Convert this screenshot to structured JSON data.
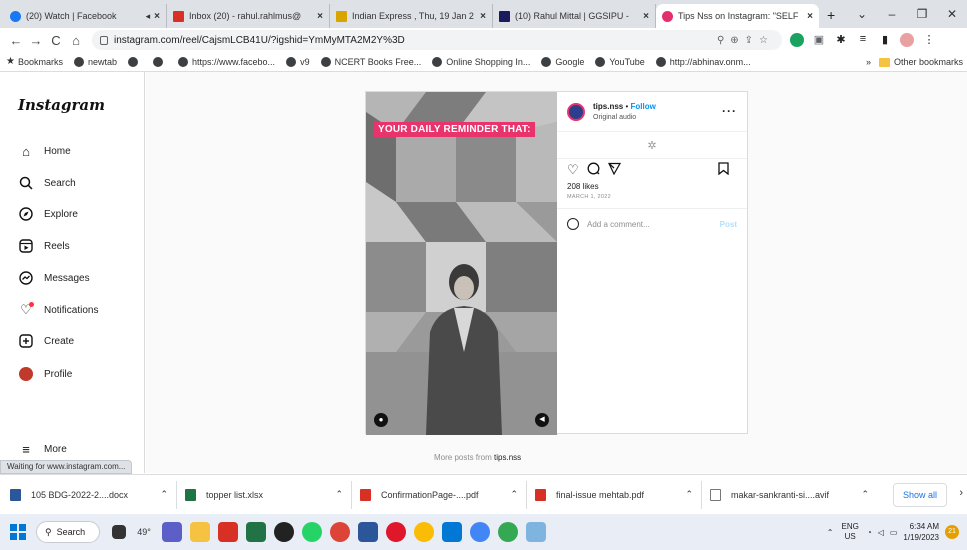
{
  "browser": {
    "tabs": [
      {
        "title": "(20) Watch | Facebook",
        "color": "#1877f2"
      },
      {
        "title": "Inbox (20) - rahul.rahlmus@",
        "color": "#d93025"
      },
      {
        "title": "Indian Express , Thu, 19 Jan 2",
        "color": "#d8a400"
      },
      {
        "title": "(10) Rahul Mittal | GGSIPU -",
        "color": "#1a1a5e"
      },
      {
        "title": "Tips Nss on Instagram: \"SELF",
        "color": "#e1306c"
      }
    ],
    "url": "instagram.com/reel/CajsmLCB41U/?igshid=YmMyMTA2M2Y%3D",
    "bookmarks": [
      "Bookmarks",
      "newtab",
      "https://www.facebo...",
      "v9",
      "NCERT Books Free...",
      "Online Shopping In...",
      "Google",
      "YouTube",
      "http://abhinav.onm..."
    ],
    "other_bookmarks": "Other bookmarks"
  },
  "instagram": {
    "logo": "Instagram",
    "nav": [
      {
        "label": "Home",
        "icon": "home-icon"
      },
      {
        "label": "Search",
        "icon": "search-icon"
      },
      {
        "label": "Explore",
        "icon": "explore-icon"
      },
      {
        "label": "Reels",
        "icon": "reels-icon"
      },
      {
        "label": "Messages",
        "icon": "messages-icon"
      },
      {
        "label": "Notifications",
        "icon": "heart-icon"
      },
      {
        "label": "Create",
        "icon": "create-icon"
      },
      {
        "label": "Profile",
        "icon": "profile-icon"
      }
    ],
    "more": "More",
    "post": {
      "overlay_text": "YOUR DAILY REMINDER THAT:",
      "username": "tips.nss",
      "follow": "Follow",
      "separator": "•",
      "audio": "Original audio",
      "likes": "208 likes",
      "date": "MARCH 1, 2022",
      "comment_placeholder": "Add a comment...",
      "post_button": "Post"
    },
    "more_posts_prefix": "More posts from",
    "more_posts_user": "tips.nss"
  },
  "status": "Waiting for www.instagram.com...",
  "downloads": {
    "items": [
      {
        "name": "105 BDG-2022-2....docx",
        "color": "#2b579a"
      },
      {
        "name": "topper list.xlsx",
        "color": "#217346"
      },
      {
        "name": "ConfirmationPage-....pdf",
        "color": "#d93025"
      },
      {
        "name": "final-issue mehtab.pdf",
        "color": "#d93025"
      },
      {
        "name": "makar-sankranti-si....avif",
        "color": "#ffffff"
      }
    ],
    "show_all": "Show all"
  },
  "taskbar": {
    "search": "Search",
    "weather": "49°",
    "lang_top": "ENG",
    "lang_bottom": "US",
    "time": "6:34 AM",
    "date": "1/19/2023",
    "badge": "21"
  }
}
